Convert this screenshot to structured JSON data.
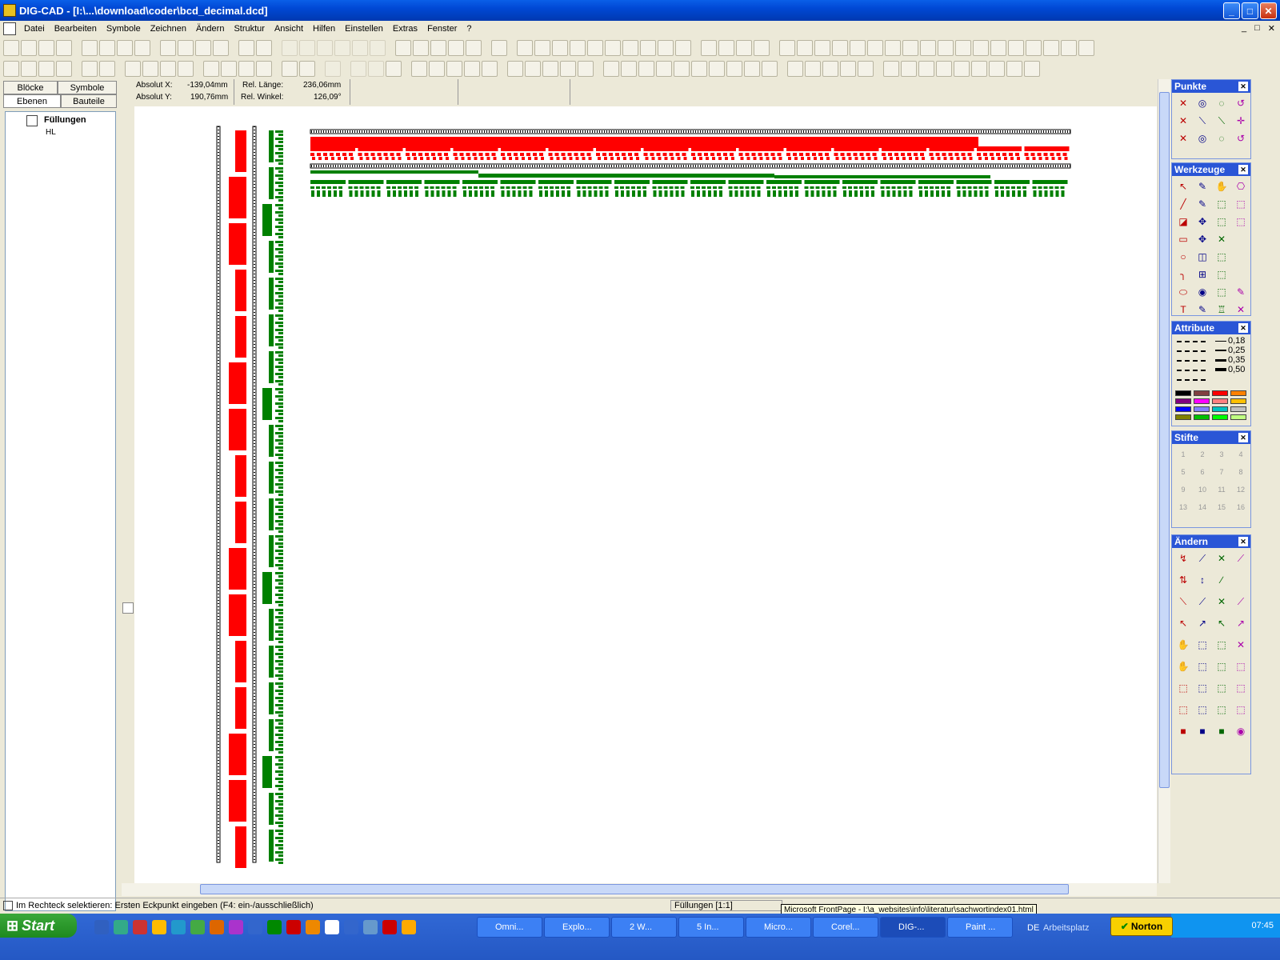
{
  "window": {
    "title": "DIG-CAD - [I:\\...\\download\\coder\\bcd_decimal.dcd]",
    "minimize": "_",
    "maximize": "□",
    "close": "✕"
  },
  "menu": [
    "Datei",
    "Bearbeiten",
    "Symbole",
    "Zeichnen",
    "Ändern",
    "Struktur",
    "Ansicht",
    "Hilfen",
    "Einstellen",
    "Extras",
    "Fenster",
    "?"
  ],
  "mdi_controls": [
    "_",
    "□",
    "✕"
  ],
  "coords": {
    "abs_x_label": "Absolut X:",
    "abs_x": "-139,04mm",
    "abs_y_label": "Absolut Y:",
    "abs_y": "190,76mm",
    "rel_len_label": "Rel. Länge:",
    "rel_len": "236,06mm",
    "rel_ang_label": "Rel. Winkel:",
    "rel_ang": "126,09°"
  },
  "left_tabs": [
    "Blöcke",
    "Symbole",
    "Ebenen",
    "Bauteile"
  ],
  "tree": {
    "root": "Füllungen",
    "child": "HL"
  },
  "palettes": {
    "punkte": "Punkte",
    "werkzeuge": "Werkzeuge",
    "attribute": "Attribute",
    "stifte": "Stifte",
    "aendern": "Ändern"
  },
  "line_widths": [
    "0,18",
    "0,25",
    "0,35",
    "0,50"
  ],
  "colors": {
    "red": "#ff0000",
    "green": "#008000",
    "title": "#0048d4"
  },
  "swatches": [
    "#000000",
    "#804040",
    "#ff0000",
    "#ff8000",
    "#800080",
    "#ff00ff",
    "#ff8080",
    "#ffc000",
    "#0000ff",
    "#8080ff",
    "#00c0c0",
    "#c0c0c0",
    "#808000",
    "#00c000",
    "#00ff00",
    "#c0ff80"
  ],
  "pens": [
    "1",
    "2",
    "3",
    "4",
    "5",
    "6",
    "7",
    "8",
    "9",
    "10",
    "11",
    "12",
    "13",
    "14",
    "15",
    "16"
  ],
  "status": {
    "message": "Im Rechteck selektieren: Ersten Eckpunkt eingeben (F4: ein-/ausschließlich)",
    "layer": "Füllungen [1:1]"
  },
  "tooltip": "Microsoft FrontPage - I:\\a_websites\\info\\literatur\\sachwortindex01.html",
  "taskbar": {
    "start": "Start",
    "tasks": [
      "Omni...",
      "Explo...",
      "2 W...",
      "5 In...",
      "Micro...",
      "Corel...",
      "DIG-...",
      "Paint ..."
    ],
    "lang": "DE",
    "arbeitsplatz": "Arbeitsplatz",
    "norton": "Norton",
    "clock": "07:45"
  }
}
